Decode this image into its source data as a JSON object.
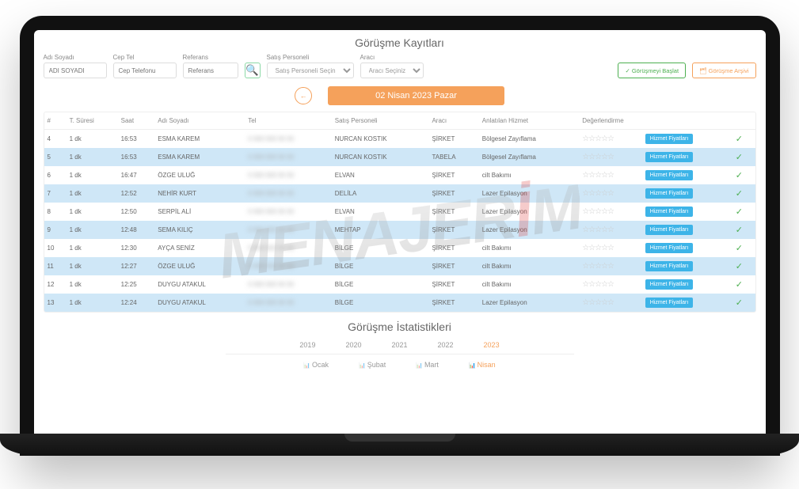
{
  "page_title": "Görüşme Kayıtları",
  "filters": {
    "name_label": "Adı Soyadı",
    "name_placeholder": "ADI SOYADI",
    "phone_label": "Cep Tel",
    "phone_placeholder": "Cep Telefonu",
    "ref_label": "Referans",
    "ref_placeholder": "Referans",
    "sales_label": "Satış Personeli",
    "sales_placeholder": "Satış Personeli Seçiniz",
    "agent_label": "Aracı",
    "agent_placeholder": "Aracı Seçiniz"
  },
  "actions": {
    "start": "✓ Görüşmeyi Başlat",
    "archive": "🗂 Görüşme Arşivi"
  },
  "date_badge": "02 Nisan 2023 Pazar",
  "columns": {
    "no": "#",
    "duration": "T. Süresi",
    "time": "Saat",
    "name": "Adı Soyadı",
    "tel": "Tel",
    "sales": "Satış Personeli",
    "agent": "Aracı",
    "service": "Anlatılan Hizmet",
    "rating": "Değerlendirme"
  },
  "price_btn_label": "Hizmet Fiyatları",
  "rows": [
    {
      "no": "4",
      "dur": "1 dk",
      "time": "16:53",
      "name": "ESMA KAREM",
      "tel": "0 000 000 00 00",
      "sales": "NURCAN KOSTIK",
      "agent": "ŞİRKET",
      "service": "Bölgesel Zayıflama"
    },
    {
      "no": "5",
      "dur": "1 dk",
      "time": "16:53",
      "name": "ESMA KAREM",
      "tel": "0 000 000 00 00",
      "sales": "NURCAN KOSTIK",
      "agent": "TABELA",
      "service": "Bölgesel Zayıflama"
    },
    {
      "no": "6",
      "dur": "1 dk",
      "time": "16:47",
      "name": "ÖZGE ULUĞ",
      "tel": "0 000 000 00 00",
      "sales": "ELVAN",
      "agent": "ŞİRKET",
      "service": "cilt Bakımı"
    },
    {
      "no": "7",
      "dur": "1 dk",
      "time": "12:52",
      "name": "NEHİR KURT",
      "tel": "0 000 000 00 00",
      "sales": "DELİLA",
      "agent": "ŞİRKET",
      "service": "Lazer Epilasyon"
    },
    {
      "no": "8",
      "dur": "1 dk",
      "time": "12:50",
      "name": "SERPİL ALİ",
      "tel": "0 000 000 00 00",
      "sales": "ELVAN",
      "agent": "ŞİRKET",
      "service": "Lazer Epilasyon"
    },
    {
      "no": "9",
      "dur": "1 dk",
      "time": "12:48",
      "name": "SEMA KILIÇ",
      "tel": "0 000 000 00 00",
      "sales": "MEHTAP",
      "agent": "ŞİRKET",
      "service": "Lazer Epilasyon"
    },
    {
      "no": "10",
      "dur": "1 dk",
      "time": "12:30",
      "name": "AYÇA SENİZ",
      "tel": "0 000 000 00 00",
      "sales": "BİLGE",
      "agent": "ŞİRKET",
      "service": "cilt Bakımı"
    },
    {
      "no": "11",
      "dur": "1 dk",
      "time": "12:27",
      "name": "ÖZGE ULUĞ",
      "tel": "0 000 000 00 00",
      "sales": "BİLGE",
      "agent": "ŞİRKET",
      "service": "cilt Bakımı"
    },
    {
      "no": "12",
      "dur": "1 dk",
      "time": "12:25",
      "name": "DUYGU ATAKUL",
      "tel": "0 000 000 00 00",
      "sales": "BİLGE",
      "agent": "ŞİRKET",
      "service": "cilt Bakımı"
    },
    {
      "no": "13",
      "dur": "1 dk",
      "time": "12:24",
      "name": "DUYGU ATAKUL",
      "tel": "0 000 000 00 00",
      "sales": "BİLGE",
      "agent": "ŞİRKET",
      "service": "Lazer Epilasyon"
    }
  ],
  "stats_title": "Görüşme İstatistikleri",
  "years": [
    "2019",
    "2020",
    "2021",
    "2022",
    "2023"
  ],
  "active_year": "2023",
  "months": [
    "Ocak",
    "Şubat",
    "Mart",
    "Nisan"
  ],
  "active_month": "Nisan",
  "watermark": "MENAJERİM"
}
